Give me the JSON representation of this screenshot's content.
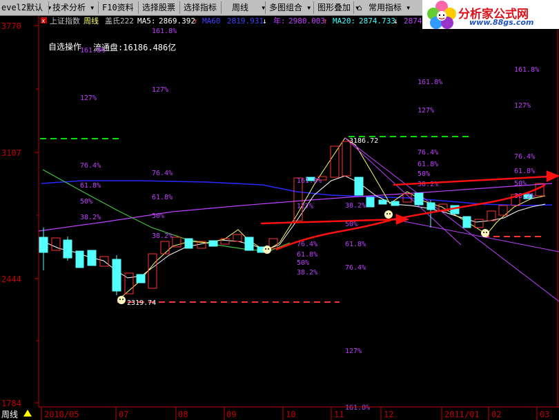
{
  "toolbar": {
    "items": [
      {
        "label": "evel2默认",
        "has_dropdown": true
      },
      {
        "label": "技术分析",
        "has_dropdown": true
      },
      {
        "label": "F10资料",
        "has_dropdown": false
      },
      {
        "label": "选择股票",
        "has_dropdown": false
      },
      {
        "label": "选择指标",
        "has_dropdown": false
      },
      {
        "label": "周线",
        "has_dropdown": true
      },
      {
        "label": "多图组合",
        "has_dropdown": true
      },
      {
        "label": "图形叠加",
        "has_dropdown": true
      },
      {
        "label": "常用指标",
        "has_dropdown": true
      }
    ]
  },
  "logo": {
    "brand": "分析家公式网",
    "url": "www.88gs.com"
  },
  "info_bar": {
    "index_name": "上证指数",
    "period": "周线",
    "indicator": "盖氏222",
    "ma5_label": "MA5:",
    "ma5_value": "2869.392",
    "ma60_label": "MA60",
    "ma60_value": "2819.931",
    "year_label": "年:",
    "year_value": "2980.003",
    "ma20_label": "MA20:",
    "ma20_value": "2874.733",
    "extra_value": "2874"
  },
  "panel_text": {
    "self_select": "自选操作",
    "float_cap": "流通盘:16186.486亿"
  },
  "y_axis": {
    "ticks": [
      "3770",
      "3107",
      "2444",
      "1784"
    ]
  },
  "x_axis": {
    "ticks": [
      "2010/05",
      "07",
      "08",
      "09",
      "10",
      "11",
      "12",
      "2011/01",
      "02",
      "03"
    ]
  },
  "annotations": {
    "high_price": "3186.72",
    "low_price": "2319.74"
  },
  "fib_labels": [
    "161.8%",
    "127%",
    "76.4%",
    "61.8%",
    "50%",
    "38.2%"
  ],
  "bottom": {
    "period_tab": "周线"
  },
  "colors": {
    "toolbar_bg": "#c0c0c0",
    "background": "#000000",
    "axis": "#c00000",
    "candle_up": "#ff3232",
    "candle_down": "#54ffff",
    "fib_text": "#c040ff",
    "ma_white": "#ffffff",
    "ma_blue": "#2828ff",
    "ma_magenta": "#c040ff",
    "ma_green": "#40c040",
    "ma_yellow": "#ffff66",
    "support_line": "#ff3232",
    "resistance_line": "#00e000",
    "trend_arrow": "#ff1010"
  }
}
